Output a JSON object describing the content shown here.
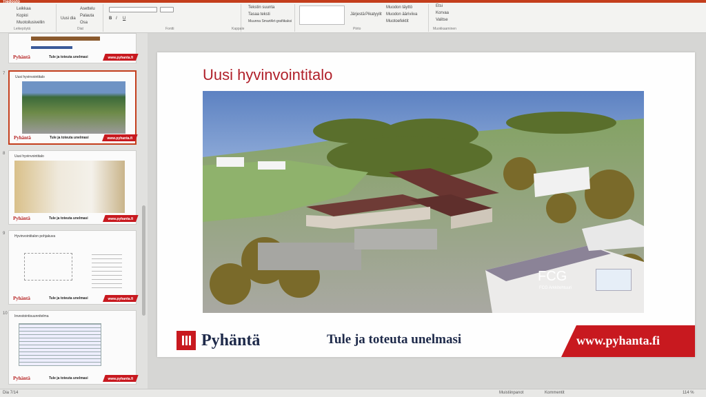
{
  "ribbon": {
    "tab": "Tiedosto",
    "clipboard": {
      "cut": "Leikkaa",
      "copy": "Kopioi",
      "format_painter": "Muotoilusivellin",
      "label": "Leikepöytä"
    },
    "slides_group": {
      "new_slide": "Uusi dia",
      "layout": "Asettelu",
      "reset": "Palauta",
      "section": "Osa",
      "label": "Diat"
    },
    "font_label": "Fontti",
    "paragraph": {
      "text_direction": "Tekstin suunta",
      "align_text": "Tasaa teksti",
      "smartart": "Muunna SmartArt-grafiikaksi",
      "label": "Kappale"
    },
    "drawing": {
      "arrange": "Järjestä",
      "quick_styles": "Pikatyylit",
      "shape_fill": "Muodon täyttö",
      "shape_outline": "Muodon ääriviiva",
      "shape_effects": "Muotoefektit",
      "label": "Piirto"
    },
    "editing": {
      "find": "Etsi",
      "replace": "Korvaa",
      "select": "Valitse",
      "label": "Muokkaaminen"
    }
  },
  "thumbnails": [
    {
      "num": "",
      "title": ""
    },
    {
      "num": "7",
      "title": "Uusi hyvinvointitalo"
    },
    {
      "num": "8",
      "title": "Uusi hyvinvointitalo"
    },
    {
      "num": "9",
      "title": "Hyvinvointitalon pohjakuva"
    },
    {
      "num": "10",
      "title": "Investointisuunnitelma"
    }
  ],
  "thumb_footer": {
    "logo": "Pyhäntä",
    "tagline": "Tule ja toteuta unelmasi",
    "url": "www.pyhanta.fi"
  },
  "slide": {
    "title": "Uusi hyvinvointitalo",
    "brand": "Pyhäntä",
    "tagline": "Tule ja toteuta unelmasi",
    "url": "www.pyhanta.fi",
    "render_credit": "FCG",
    "render_credit_sub": "FCG Arkkitehtuuri"
  },
  "status": {
    "slide_indicator": "Dia 7/14",
    "notes": "Muistiinpanot",
    "comments": "Kommentit",
    "zoom": "114 %"
  },
  "colors": {
    "accent": "#c43e1c",
    "brand_red": "#c8191f",
    "navy": "#1e2a4a"
  }
}
